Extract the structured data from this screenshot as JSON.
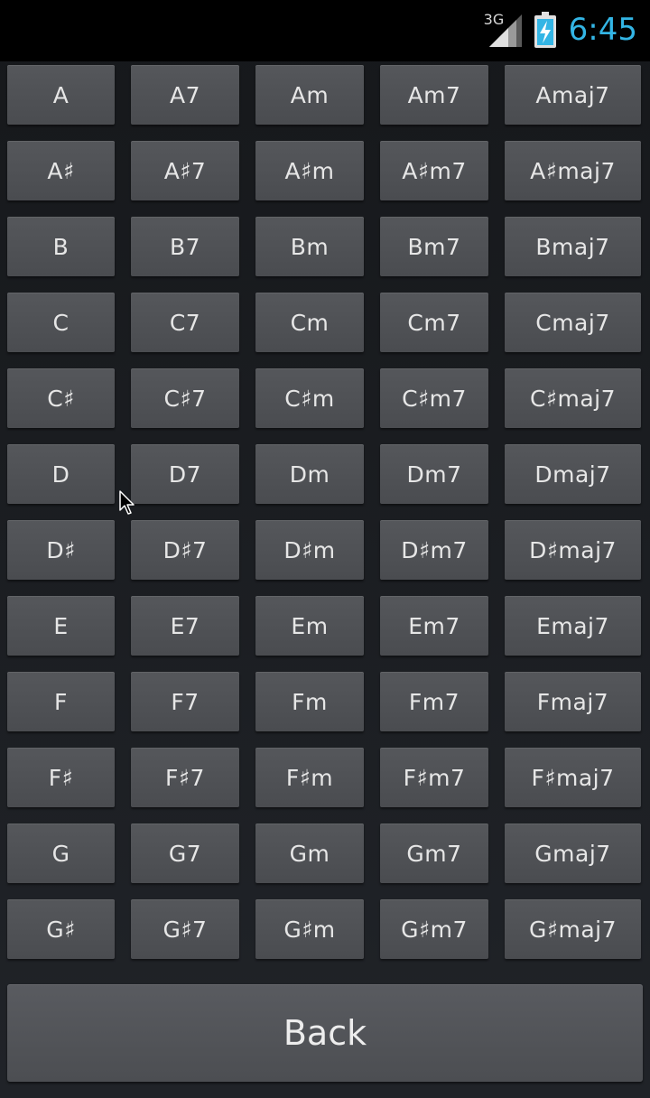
{
  "status_bar": {
    "network_type": "3G",
    "time": "6:45",
    "clock_color": "#33b5e5",
    "icons": [
      "signal-icon",
      "battery-charging-icon"
    ]
  },
  "chord_grid": {
    "rows": [
      [
        "A",
        "A7",
        "Am",
        "Am7",
        "Amaj7"
      ],
      [
        "A♯",
        "A♯7",
        "A♯m",
        "A♯m7",
        "A♯maj7"
      ],
      [
        "B",
        "B7",
        "Bm",
        "Bm7",
        "Bmaj7"
      ],
      [
        "C",
        "C7",
        "Cm",
        "Cm7",
        "Cmaj7"
      ],
      [
        "C♯",
        "C♯7",
        "C♯m",
        "C♯m7",
        "C♯maj7"
      ],
      [
        "D",
        "D7",
        "Dm",
        "Dm7",
        "Dmaj7"
      ],
      [
        "D♯",
        "D♯7",
        "D♯m",
        "D♯m7",
        "D♯maj7"
      ],
      [
        "E",
        "E7",
        "Em",
        "Em7",
        "Emaj7"
      ],
      [
        "F",
        "F7",
        "Fm",
        "Fm7",
        "Fmaj7"
      ],
      [
        "F♯",
        "F♯7",
        "F♯m",
        "F♯m7",
        "F♯maj7"
      ],
      [
        "G",
        "G7",
        "Gm",
        "Gm7",
        "Gmaj7"
      ],
      [
        "G♯",
        "G♯7",
        "G♯m",
        "G♯m7",
        "G♯maj7"
      ]
    ]
  },
  "footer": {
    "back_label": "Back"
  }
}
